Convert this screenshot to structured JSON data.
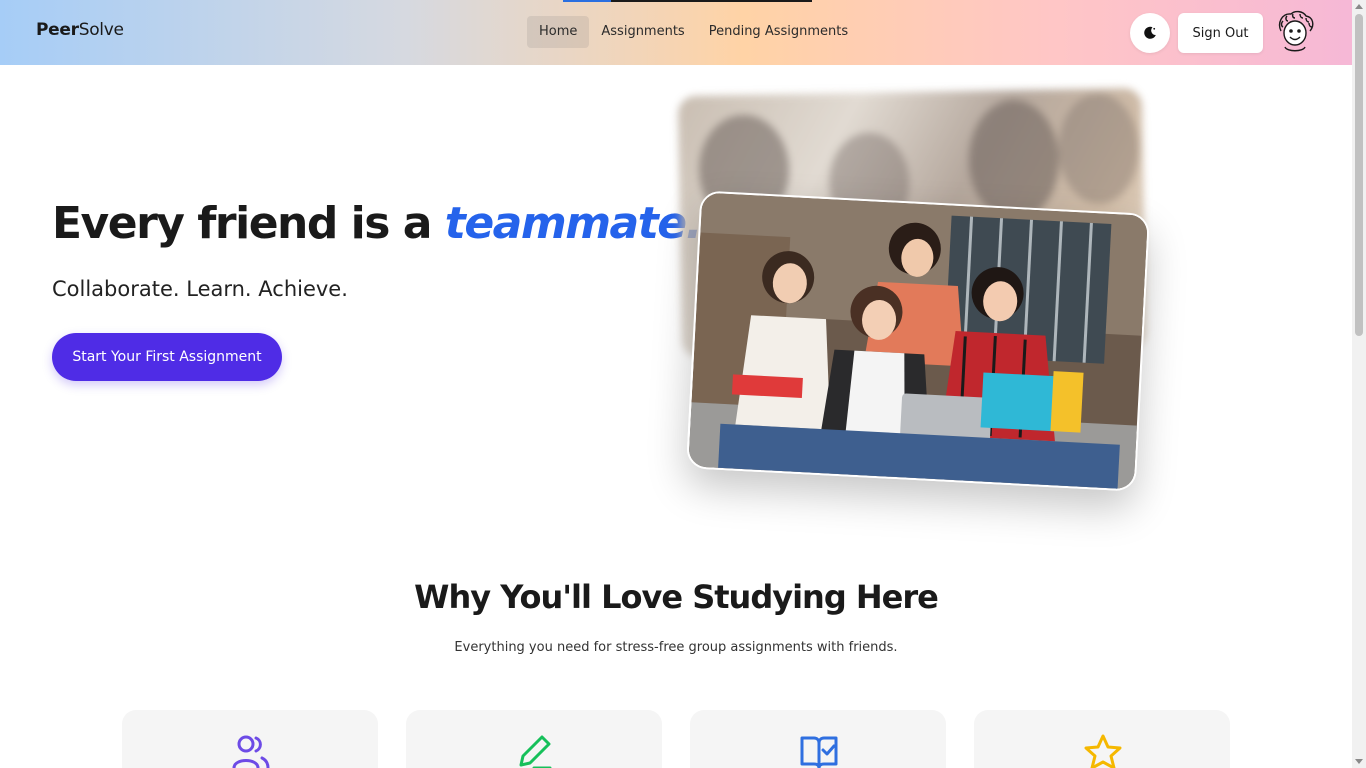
{
  "navbar": {
    "brand_bold": "Peer",
    "brand_regular": "Solve",
    "links": [
      {
        "label": "Home",
        "active": true
      },
      {
        "label": "Assignments",
        "active": false
      },
      {
        "label": "Pending Assignments",
        "active": false
      }
    ],
    "theme_icon": "moon-icon",
    "sign_out_label": "Sign Out",
    "avatar_icon": "user-avatar-icon"
  },
  "hero": {
    "title_prefix": "Every friend is a",
    "title_accent": "teammate.",
    "subtitle": "Collaborate. Learn. Achieve.",
    "cta_label": "Start Your First Assignment",
    "accent_color": "#2563eb",
    "cta_color": "#4f2ce6"
  },
  "features": {
    "title": "Why You'll Love Studying Here",
    "subtitle": "Everything you need for stress-free group assignments with friends.",
    "cards": [
      {
        "icon": "users-icon",
        "color": "#6d4be6"
      },
      {
        "icon": "pencil-icon",
        "color": "#16c05a"
      },
      {
        "icon": "book-check-icon",
        "color": "#2f6fe0"
      },
      {
        "icon": "star-icon",
        "color": "#f5b800"
      }
    ]
  }
}
